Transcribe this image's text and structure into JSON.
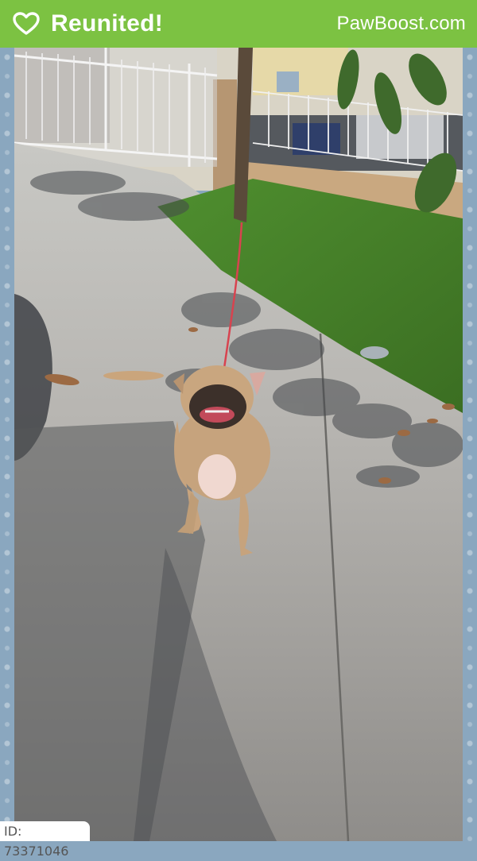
{
  "header": {
    "title": "Reunited!",
    "brand": "PawBoost.com",
    "background_color": "#7cc242",
    "icon": "heart-outline-icon"
  },
  "photo": {
    "border_color": "#8aa7bf",
    "border_icon": "paw-print-icon"
  },
  "footer": {
    "id_label": "ID: 73371046"
  }
}
